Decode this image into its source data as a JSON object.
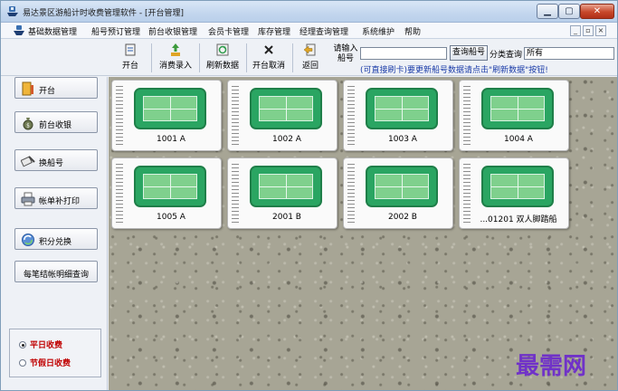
{
  "window": {
    "title": "易达景区游船计时收费管理软件 - [开台管理]",
    "controls": {
      "minimize": "▁",
      "maximize": "▢",
      "close": "✕"
    }
  },
  "menu": {
    "items": [
      "基础数据管理",
      "船号预订管理",
      "前台收银管理",
      "会员卡管理",
      "库存管理",
      "经理查询管理",
      "系统维护",
      "帮助"
    ],
    "mdi": {
      "minimize": "_",
      "restore": "▫",
      "close": "×"
    }
  },
  "toolbar": {
    "buttons": [
      "开台",
      "消费录入",
      "刷新数据",
      "开台取消",
      "返回"
    ],
    "search_label": "请输入船号",
    "search_value": "",
    "search_button": "查询船号",
    "category_label": "分类查询",
    "category_value": "所有",
    "hint": "(可直接刷卡)要更新船号数据请点击\"刷新数据\"按钮!"
  },
  "sidebar": {
    "buttons": [
      "开台",
      "前台收银",
      "换船号",
      "帐单补打印",
      "积分兑换",
      "每笔结帐明细查询"
    ],
    "rate_options": [
      {
        "label": "平日收费",
        "selected": true
      },
      {
        "label": "节假日收费",
        "selected": false
      }
    ]
  },
  "boats": [
    "1001 A",
    "1002 A",
    "1003 A",
    "1004 A",
    "1005 A",
    "2001 B",
    "2002 B",
    "...01201 双人脚踏船"
  ],
  "watermark": "最需网",
  "colors": {
    "card_green": "#2aa562",
    "hint_blue": "#1b3ca8",
    "radio_red": "#c00000",
    "watermark_purple": "#7032c8"
  }
}
